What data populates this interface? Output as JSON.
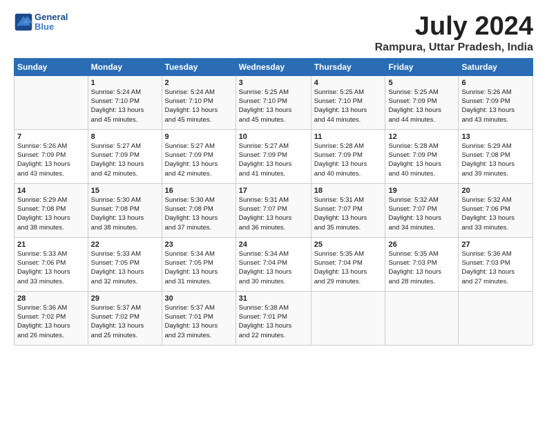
{
  "header": {
    "logo_line1": "General",
    "logo_line2": "Blue",
    "title": "July 2024",
    "subtitle": "Rampura, Uttar Pradesh, India"
  },
  "days_of_week": [
    "Sunday",
    "Monday",
    "Tuesday",
    "Wednesday",
    "Thursday",
    "Friday",
    "Saturday"
  ],
  "weeks": [
    [
      {
        "day": "",
        "info": ""
      },
      {
        "day": "1",
        "info": "Sunrise: 5:24 AM\nSunset: 7:10 PM\nDaylight: 13 hours\nand 45 minutes."
      },
      {
        "day": "2",
        "info": "Sunrise: 5:24 AM\nSunset: 7:10 PM\nDaylight: 13 hours\nand 45 minutes."
      },
      {
        "day": "3",
        "info": "Sunrise: 5:25 AM\nSunset: 7:10 PM\nDaylight: 13 hours\nand 45 minutes."
      },
      {
        "day": "4",
        "info": "Sunrise: 5:25 AM\nSunset: 7:10 PM\nDaylight: 13 hours\nand 44 minutes."
      },
      {
        "day": "5",
        "info": "Sunrise: 5:25 AM\nSunset: 7:09 PM\nDaylight: 13 hours\nand 44 minutes."
      },
      {
        "day": "6",
        "info": "Sunrise: 5:26 AM\nSunset: 7:09 PM\nDaylight: 13 hours\nand 43 minutes."
      }
    ],
    [
      {
        "day": "7",
        "info": "Sunrise: 5:26 AM\nSunset: 7:09 PM\nDaylight: 13 hours\nand 43 minutes."
      },
      {
        "day": "8",
        "info": "Sunrise: 5:27 AM\nSunset: 7:09 PM\nDaylight: 13 hours\nand 42 minutes."
      },
      {
        "day": "9",
        "info": "Sunrise: 5:27 AM\nSunset: 7:09 PM\nDaylight: 13 hours\nand 42 minutes."
      },
      {
        "day": "10",
        "info": "Sunrise: 5:27 AM\nSunset: 7:09 PM\nDaylight: 13 hours\nand 41 minutes."
      },
      {
        "day": "11",
        "info": "Sunrise: 5:28 AM\nSunset: 7:09 PM\nDaylight: 13 hours\nand 40 minutes."
      },
      {
        "day": "12",
        "info": "Sunrise: 5:28 AM\nSunset: 7:09 PM\nDaylight: 13 hours\nand 40 minutes."
      },
      {
        "day": "13",
        "info": "Sunrise: 5:29 AM\nSunset: 7:08 PM\nDaylight: 13 hours\nand 39 minutes."
      }
    ],
    [
      {
        "day": "14",
        "info": "Sunrise: 5:29 AM\nSunset: 7:08 PM\nDaylight: 13 hours\nand 38 minutes."
      },
      {
        "day": "15",
        "info": "Sunrise: 5:30 AM\nSunset: 7:08 PM\nDaylight: 13 hours\nand 38 minutes."
      },
      {
        "day": "16",
        "info": "Sunrise: 5:30 AM\nSunset: 7:08 PM\nDaylight: 13 hours\nand 37 minutes."
      },
      {
        "day": "17",
        "info": "Sunrise: 5:31 AM\nSunset: 7:07 PM\nDaylight: 13 hours\nand 36 minutes."
      },
      {
        "day": "18",
        "info": "Sunrise: 5:31 AM\nSunset: 7:07 PM\nDaylight: 13 hours\nand 35 minutes."
      },
      {
        "day": "19",
        "info": "Sunrise: 5:32 AM\nSunset: 7:07 PM\nDaylight: 13 hours\nand 34 minutes."
      },
      {
        "day": "20",
        "info": "Sunrise: 5:32 AM\nSunset: 7:06 PM\nDaylight: 13 hours\nand 33 minutes."
      }
    ],
    [
      {
        "day": "21",
        "info": "Sunrise: 5:33 AM\nSunset: 7:06 PM\nDaylight: 13 hours\nand 33 minutes."
      },
      {
        "day": "22",
        "info": "Sunrise: 5:33 AM\nSunset: 7:05 PM\nDaylight: 13 hours\nand 32 minutes."
      },
      {
        "day": "23",
        "info": "Sunrise: 5:34 AM\nSunset: 7:05 PM\nDaylight: 13 hours\nand 31 minutes."
      },
      {
        "day": "24",
        "info": "Sunrise: 5:34 AM\nSunset: 7:04 PM\nDaylight: 13 hours\nand 30 minutes."
      },
      {
        "day": "25",
        "info": "Sunrise: 5:35 AM\nSunset: 7:04 PM\nDaylight: 13 hours\nand 29 minutes."
      },
      {
        "day": "26",
        "info": "Sunrise: 5:35 AM\nSunset: 7:03 PM\nDaylight: 13 hours\nand 28 minutes."
      },
      {
        "day": "27",
        "info": "Sunrise: 5:36 AM\nSunset: 7:03 PM\nDaylight: 13 hours\nand 27 minutes."
      }
    ],
    [
      {
        "day": "28",
        "info": "Sunrise: 5:36 AM\nSunset: 7:02 PM\nDaylight: 13 hours\nand 26 minutes."
      },
      {
        "day": "29",
        "info": "Sunrise: 5:37 AM\nSunset: 7:02 PM\nDaylight: 13 hours\nand 25 minutes."
      },
      {
        "day": "30",
        "info": "Sunrise: 5:37 AM\nSunset: 7:01 PM\nDaylight: 13 hours\nand 23 minutes."
      },
      {
        "day": "31",
        "info": "Sunrise: 5:38 AM\nSunset: 7:01 PM\nDaylight: 13 hours\nand 22 minutes."
      },
      {
        "day": "",
        "info": ""
      },
      {
        "day": "",
        "info": ""
      },
      {
        "day": "",
        "info": ""
      }
    ]
  ]
}
